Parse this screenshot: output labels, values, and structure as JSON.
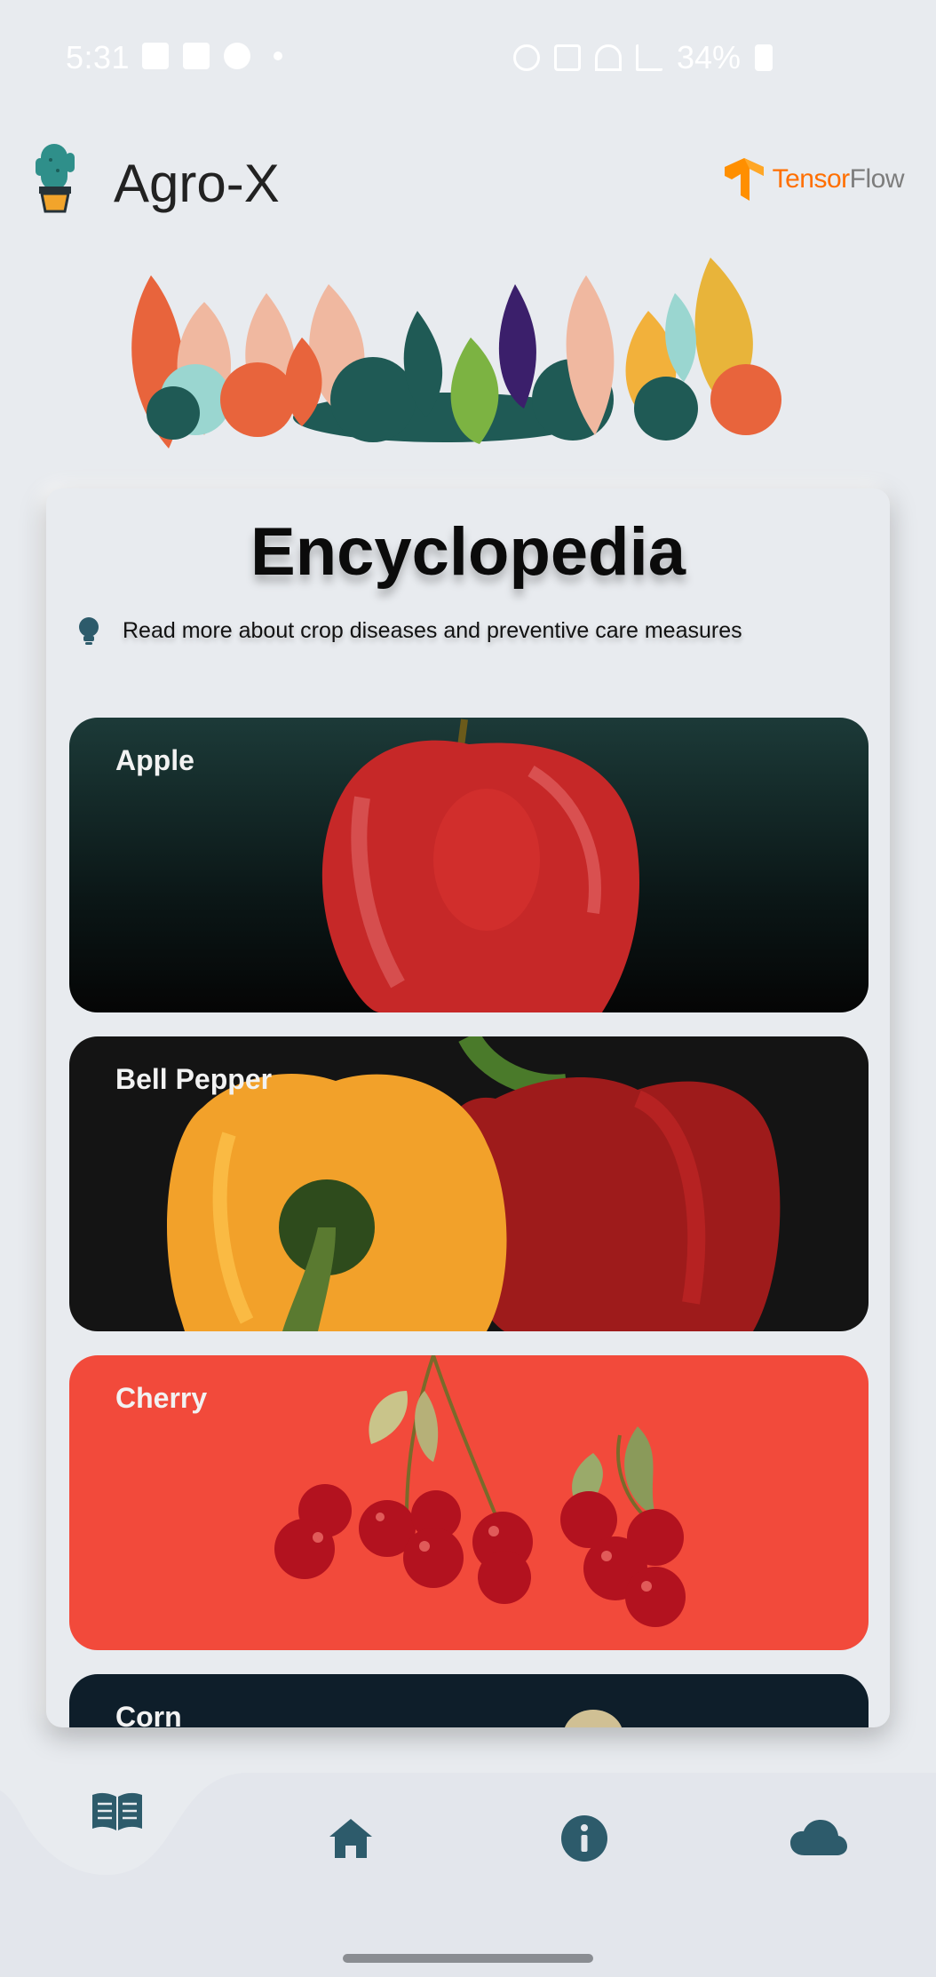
{
  "status_bar": {
    "time": "5:31",
    "battery": "34%"
  },
  "app_bar": {
    "title": "Agro-X",
    "partner_logo": {
      "part1": "Tensor",
      "part2": "Flow"
    }
  },
  "encyclopedia": {
    "title": "Encyclopedia",
    "hint": "Read more about crop diseases and preventive care measures",
    "crops": [
      {
        "label": "Apple",
        "bg": "#0f2a2a"
      },
      {
        "label": "Bell Pepper",
        "bg": "#141414"
      },
      {
        "label": "Cherry",
        "bg": "#f24a3b"
      },
      {
        "label": "Corn",
        "bg": "#0e1e2a"
      }
    ]
  },
  "bottom_nav": {
    "items": [
      {
        "icon": "book-icon"
      },
      {
        "icon": "home-icon"
      },
      {
        "icon": "info-icon"
      },
      {
        "icon": "cloud-icon"
      }
    ]
  },
  "colors": {
    "accent": "#2d5b6b",
    "background": "#e8ebef",
    "tensorflow_orange": "#ff6f00"
  }
}
